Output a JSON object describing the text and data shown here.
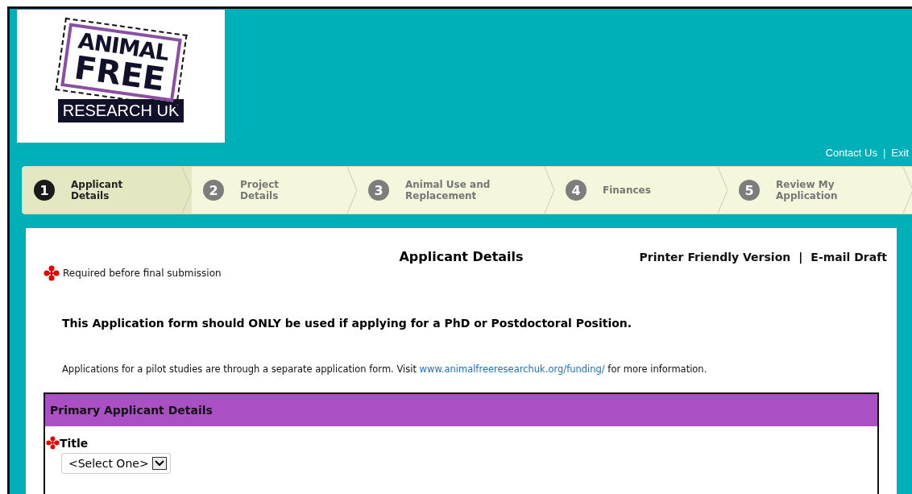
{
  "logo": {
    "line_1": "ANIMAL",
    "line_2": "FREE",
    "line_3": "RESEARCH UK"
  },
  "top_links": [
    "Contact Us",
    "Exit"
  ],
  "top_links_separator": "|",
  "steps": [
    {
      "number": "1",
      "label": "Applicant Details",
      "selected": true
    },
    {
      "number": "2",
      "label": "Project Details",
      "selected": false
    },
    {
      "number": "3",
      "label": "Animal Use and Replacement",
      "selected": false
    },
    {
      "number": "4",
      "label": "Finances",
      "selected": false
    },
    {
      "number": "5",
      "label": "Review My Application",
      "selected": false
    }
  ],
  "page_title": "Applicant Details",
  "page_links": [
    "Printer Friendly Version",
    "E-mail Draft"
  ],
  "page_links_separator": "|",
  "required_note": "Required before final submission",
  "notice": "This Application form should ONLY be used if applying for a PhD or Postdoctoral Position.",
  "info": {
    "before": "Applications for a pilot studies are through a separate application form. Visit",
    "link": "www.animalfreeresearchuk.org/funding/",
    "after": "for more information."
  },
  "section": {
    "title": "Primary Applicant Details",
    "fields": [
      {
        "label": "Title",
        "required": true,
        "value": "<Select One>"
      }
    ]
  }
}
